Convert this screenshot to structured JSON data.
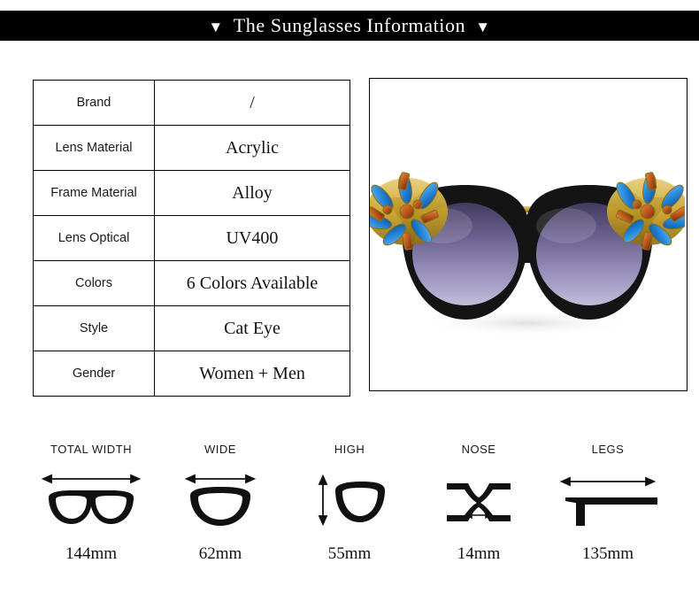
{
  "header": {
    "title": "The Sunglasses Information",
    "left_marker": "▼",
    "right_marker": "▼",
    "background_color": "#000000",
    "text_color": "#ffffff"
  },
  "spec_table": {
    "rows": [
      {
        "label": "Brand",
        "value": "/"
      },
      {
        "label": "Lens Material",
        "value": "Acrylic"
      },
      {
        "label": "Frame Material",
        "value": "Alloy"
      },
      {
        "label": "Lens Optical",
        "value": "UV400"
      },
      {
        "label": "Colors",
        "value": "6 Colors Available"
      },
      {
        "label": "Style",
        "value": "Cat Eye"
      },
      {
        "label": "Gender",
        "value": "Women + Men"
      }
    ]
  },
  "product_image": {
    "alt": "jeweled-cat-eye-sunglasses",
    "frame_color": "#141414",
    "lens_gradient_top": "#4a3f66",
    "lens_gradient_bottom": "#b9b0d4",
    "browbar_color": "#c9a227",
    "jewel_blue": "#1f7fd4",
    "jewel_amber": "#b3521a",
    "jewel_gold": "#d9b24c"
  },
  "measurements": [
    {
      "label": "TOTAL WIDTH",
      "value": "144mm",
      "icon": "full-frame-width-icon"
    },
    {
      "label": "WIDE",
      "value": "62mm",
      "icon": "lens-width-icon"
    },
    {
      "label": "HIGH",
      "value": "55mm",
      "icon": "lens-height-icon"
    },
    {
      "label": "NOSE",
      "value": "14mm",
      "icon": "nose-bridge-icon"
    },
    {
      "label": "LEGS",
      "value": "135mm",
      "icon": "temple-arm-icon"
    }
  ]
}
